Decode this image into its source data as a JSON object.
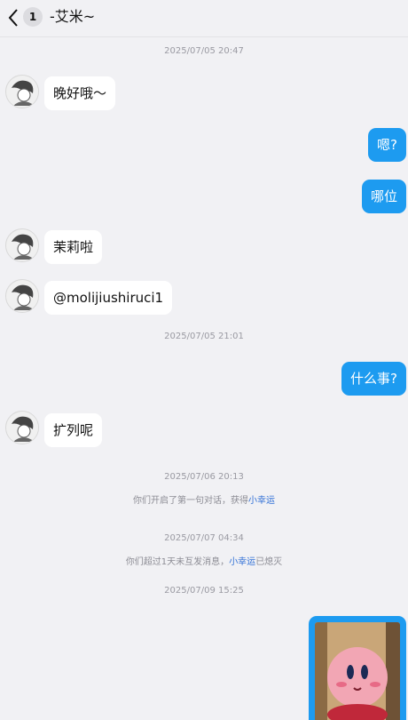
{
  "header": {
    "back_icon": "chevron-left-icon",
    "unread_badge": "1",
    "contact_name": "-艾米~"
  },
  "messages": [
    {
      "type": "time",
      "text": "2025/07/05 20:47"
    },
    {
      "type": "in",
      "text": "晚好哦～"
    },
    {
      "type": "out",
      "text": "嗯?"
    },
    {
      "type": "out",
      "text": "哪位"
    },
    {
      "type": "in",
      "text": "茉莉啦"
    },
    {
      "type": "in",
      "text": "@molijiushiruci1"
    },
    {
      "type": "time",
      "text": "2025/07/05 21:01"
    },
    {
      "type": "out",
      "text": "什么事?"
    },
    {
      "type": "in",
      "text": "扩列呢"
    },
    {
      "type": "time",
      "text": "2025/07/06 20:13"
    },
    {
      "type": "system",
      "text_before": "你们开启了第一句对话，获得",
      "link": "小幸运",
      "text_after": ""
    },
    {
      "type": "time",
      "text": "2025/07/07 04:34"
    },
    {
      "type": "system",
      "text_before": "你们超过1天未互发消息，",
      "link": "小幸运",
      "text_after": "已熄灭"
    },
    {
      "type": "time",
      "text": "2025/07/09 15:25"
    },
    {
      "type": "out_image",
      "image": "kirby-plush-photo"
    }
  ],
  "colors": {
    "outgoing_bubble": "#1d9bf0",
    "incoming_bubble": "#ffffff",
    "background": "#f1f1f4",
    "link": "#2f6fd6"
  }
}
